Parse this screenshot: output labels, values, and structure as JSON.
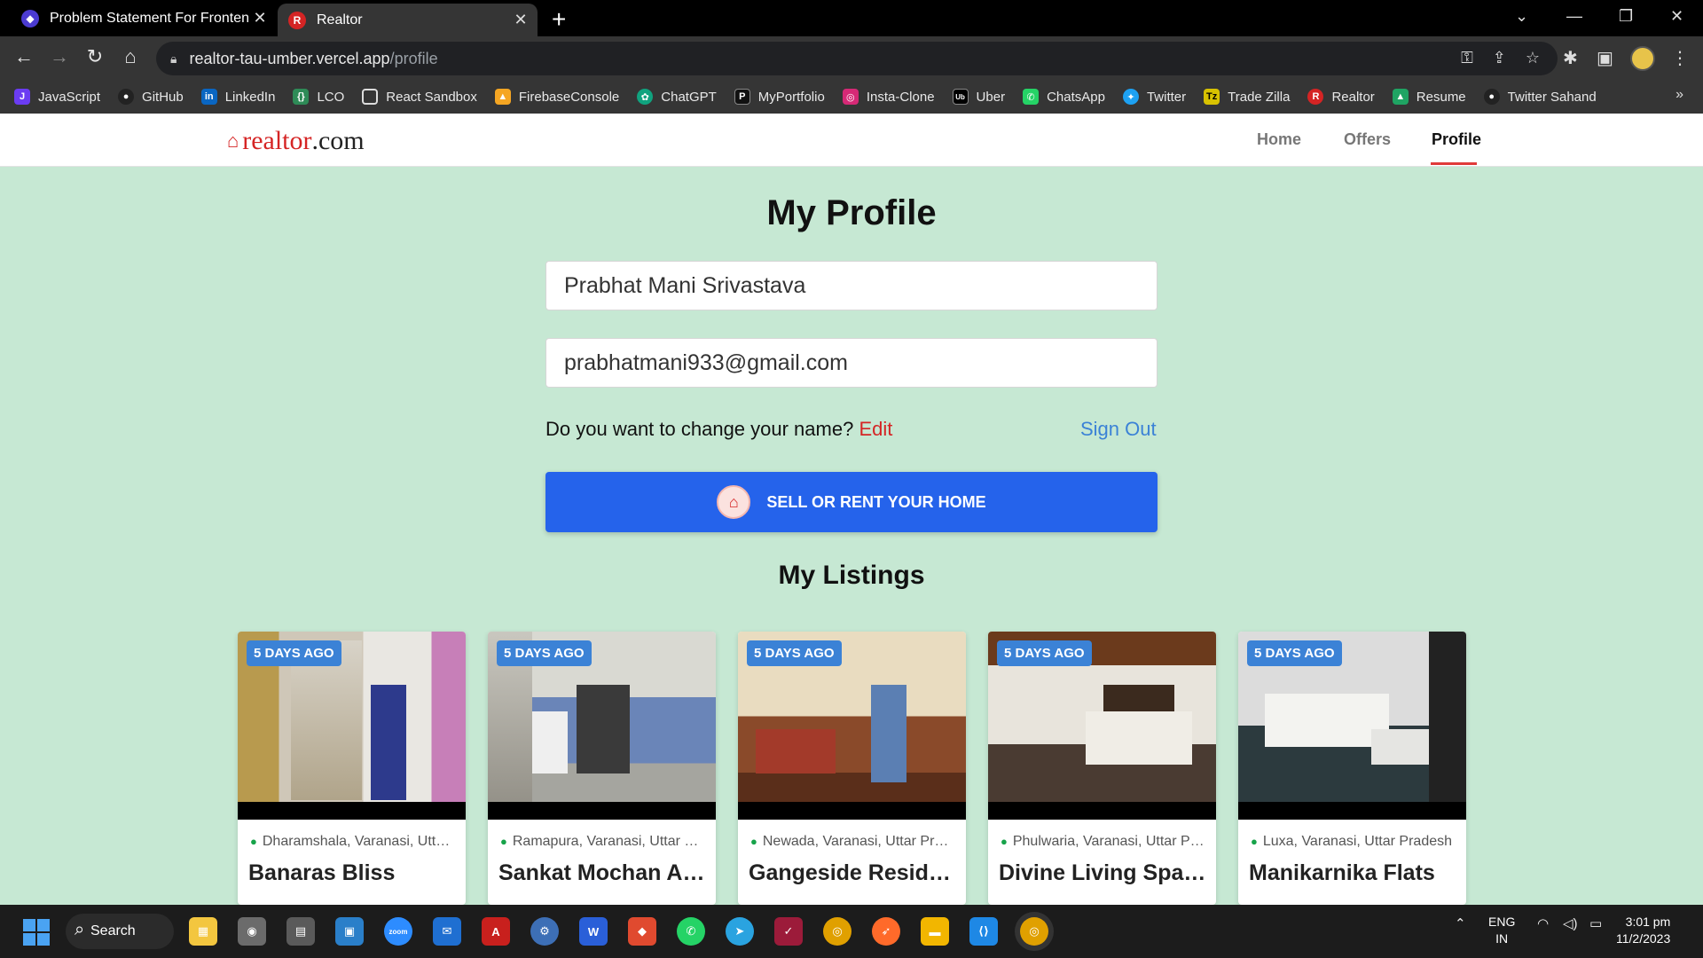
{
  "browser": {
    "tabs": [
      {
        "title": "Problem Statement For Frontend",
        "favicon_color": "#4b3bd1"
      },
      {
        "title": "Realtor",
        "favicon_color": "#d52424"
      }
    ],
    "url_host": "realtor-tau-umber.vercel.app",
    "url_path": "/profile",
    "bookmarks": [
      {
        "label": "JavaScript",
        "icon": "js-icon",
        "color": "#6b3cf2"
      },
      {
        "label": "GitHub",
        "icon": "github-icon",
        "color": "#222"
      },
      {
        "label": "LinkedIn",
        "icon": "linkedin-icon",
        "color": "#0a66c2"
      },
      {
        "label": "LCO",
        "icon": "lco-icon",
        "color": "#2e8b57"
      },
      {
        "label": "React Sandbox",
        "icon": "sandbox-icon",
        "color": "#444"
      },
      {
        "label": "FirebaseConsole",
        "icon": "firebase-icon",
        "color": "#f5a623"
      },
      {
        "label": "ChatGPT",
        "icon": "chatgpt-icon",
        "color": "#10a37f"
      },
      {
        "label": "MyPortfolio",
        "icon": "portfolio-icon",
        "color": "#111"
      },
      {
        "label": "Insta-Clone",
        "icon": "instagram-icon",
        "color": "#d62976"
      },
      {
        "label": "Uber",
        "icon": "uber-icon",
        "color": "#000"
      },
      {
        "label": "ChatsApp",
        "icon": "whatsapp-icon",
        "color": "#25d366"
      },
      {
        "label": "Twitter",
        "icon": "twitter-icon",
        "color": "#1da1f2"
      },
      {
        "label": "Trade Zilla",
        "icon": "tradezilla-icon",
        "color": "#d8c200"
      },
      {
        "label": "Realtor",
        "icon": "realtor-icon",
        "color": "#d52424"
      },
      {
        "label": "Resume",
        "icon": "drive-icon",
        "color": "#1fa463"
      },
      {
        "label": "Twitter Sahand",
        "icon": "github-icon",
        "color": "#222"
      }
    ]
  },
  "site": {
    "logo_part1": "realtor",
    "logo_part2": ".com",
    "nav": [
      "Home",
      "Offers",
      "Profile"
    ]
  },
  "profile": {
    "title": "My Profile",
    "name": "Prabhat Mani Srivastava",
    "email": "prabhatmani933@gmail.com",
    "change_prompt": "Do you want to change your name?",
    "edit_label": "Edit",
    "signout_label": "Sign Out",
    "cta_label": "SELL OR RENT YOUR HOME"
  },
  "listings": {
    "title": "My Listings",
    "items": [
      {
        "badge": "5 DAYS AGO",
        "location": "Dharamshala, Varanasi, Uttar Pradesh",
        "name": "Banaras Bliss",
        "img": "hallway-photo"
      },
      {
        "badge": "5 DAYS AGO",
        "location": "Ramapura, Varanasi, Uttar Pradesh",
        "name": "Sankat Mochan Apartments",
        "img": "building-photo"
      },
      {
        "badge": "5 DAYS AGO",
        "location": "Newada, Varanasi, Uttar Pradesh",
        "name": "Gangeside Residences",
        "img": "lounge-photo"
      },
      {
        "badge": "5 DAYS AGO",
        "location": "Phulwaria, Varanasi, Uttar Pradesh",
        "name": "Divine Living Spaces",
        "img": "bedroom-photo"
      },
      {
        "badge": "5 DAYS AGO",
        "location": "Luxa, Varanasi, Uttar Pradesh",
        "name": "Manikarnika Flats",
        "img": "daybed-photo"
      }
    ]
  },
  "taskbar": {
    "search_label": "Search",
    "lang_top": "ENG",
    "lang_bottom": "IN",
    "time": "3:01 pm",
    "date": "11/2/2023"
  }
}
